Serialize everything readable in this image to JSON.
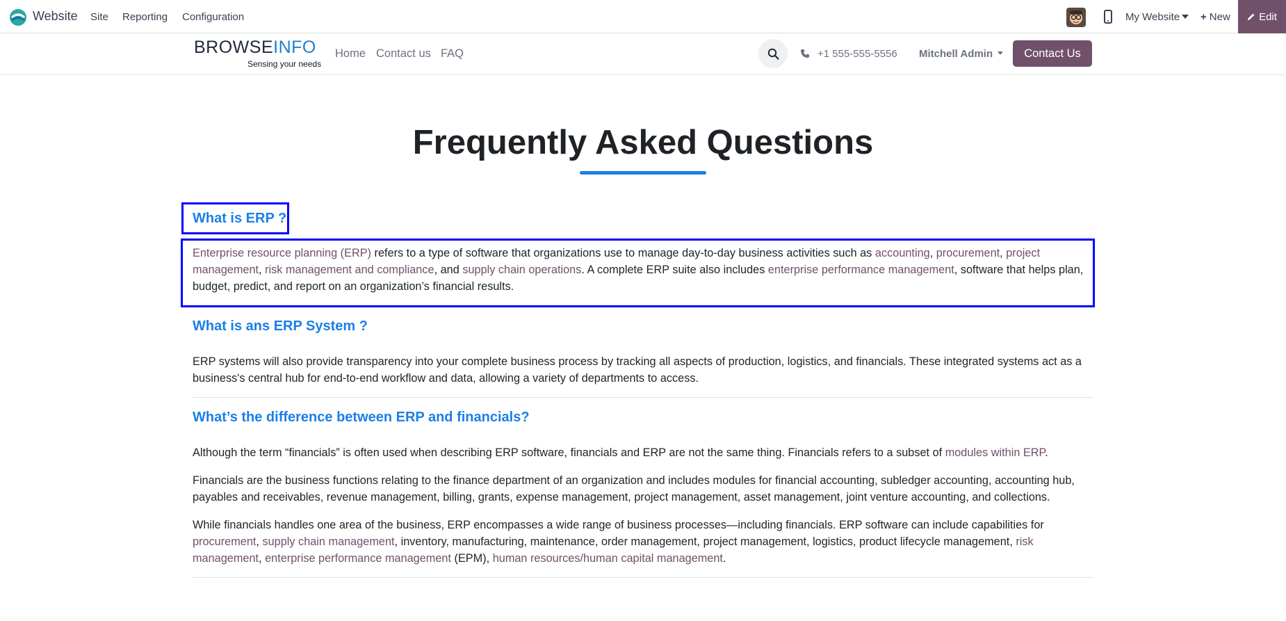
{
  "systray": {
    "app_name": "Website",
    "menu": [
      "Site",
      "Reporting",
      "Configuration"
    ],
    "my_website": "My Website",
    "new_label": "New",
    "edit_label": "Edit"
  },
  "header": {
    "brand_part1": "BROWSE",
    "brand_part2": "INFO",
    "brand_tagline": "Sensing your needs",
    "nav": [
      "Home",
      "Contact us",
      "FAQ"
    ],
    "phone": "+1 555-555-5556",
    "user": "Mitchell Admin",
    "contact_button": "Contact Us"
  },
  "main": {
    "title": "Frequently Asked Questions",
    "faq": [
      {
        "question": "What is ERP ?",
        "paragraphs": [
          [
            {
              "text": "Enterprise resource planning (ERP)",
              "link": true
            },
            {
              "text": " refers to a type of software that organizations use to manage day-to-day business activities such as "
            },
            {
              "text": "accounting",
              "link": true
            },
            {
              "text": ", "
            },
            {
              "text": "procurement",
              "link": true
            },
            {
              "text": ", "
            },
            {
              "text": "project management",
              "link": true
            },
            {
              "text": ", "
            },
            {
              "text": "risk management and compliance",
              "link": true
            },
            {
              "text": ", and "
            },
            {
              "text": "supply chain operations",
              "link": true
            },
            {
              "text": ". A complete ERP suite also includes "
            },
            {
              "text": "enterprise performance management",
              "link": true
            },
            {
              "text": ", software that helps plan, budget, predict, and report on an organization’s financial results."
            }
          ]
        ]
      },
      {
        "question": "What is ans ERP System ?",
        "paragraphs": [
          [
            {
              "text": "ERP systems will also provide transparency into your complete business process by tracking all aspects of production, logistics, and financials. These integrated systems act as a business's central hub for end-to-end workflow and data, allowing a variety of departments to access."
            }
          ]
        ]
      },
      {
        "question": "What’s the difference between ERP and financials?",
        "paragraphs": [
          [
            {
              "text": "Although the term “financials” is often used when describing ERP software, financials and ERP are not the same thing. Financials refers to a subset of "
            },
            {
              "text": "modules within ERP",
              "link": true
            },
            {
              "text": "."
            }
          ],
          [
            {
              "text": "Financials are the business functions relating to the finance department of an organization and includes modules for financial accounting, subledger accounting, accounting hub, payables and receivables, revenue management, billing, grants, expense management, project management, asset management, joint venture accounting, and collections."
            }
          ],
          [
            {
              "text": "While financials handles one area of the business, ERP encompasses a wide range of business processes—including financials. ERP software can include capabilities for "
            },
            {
              "text": "procurement",
              "link": true
            },
            {
              "text": ", "
            },
            {
              "text": "supply chain management",
              "link": true
            },
            {
              "text": ", inventory, manufacturing, maintenance, order management, project management, logistics, product lifecycle management, "
            },
            {
              "text": "risk management",
              "link": true
            },
            {
              "text": ", "
            },
            {
              "text": "enterprise performance management",
              "link": true
            },
            {
              "text": " (EPM), "
            },
            {
              "text": "human resources/human capital management",
              "link": true
            },
            {
              "text": "."
            }
          ]
        ]
      }
    ]
  },
  "colors": {
    "brand_purple": "#71506a",
    "heading_blue": "#1a7fe6",
    "highlight_box": "#0000ff"
  }
}
